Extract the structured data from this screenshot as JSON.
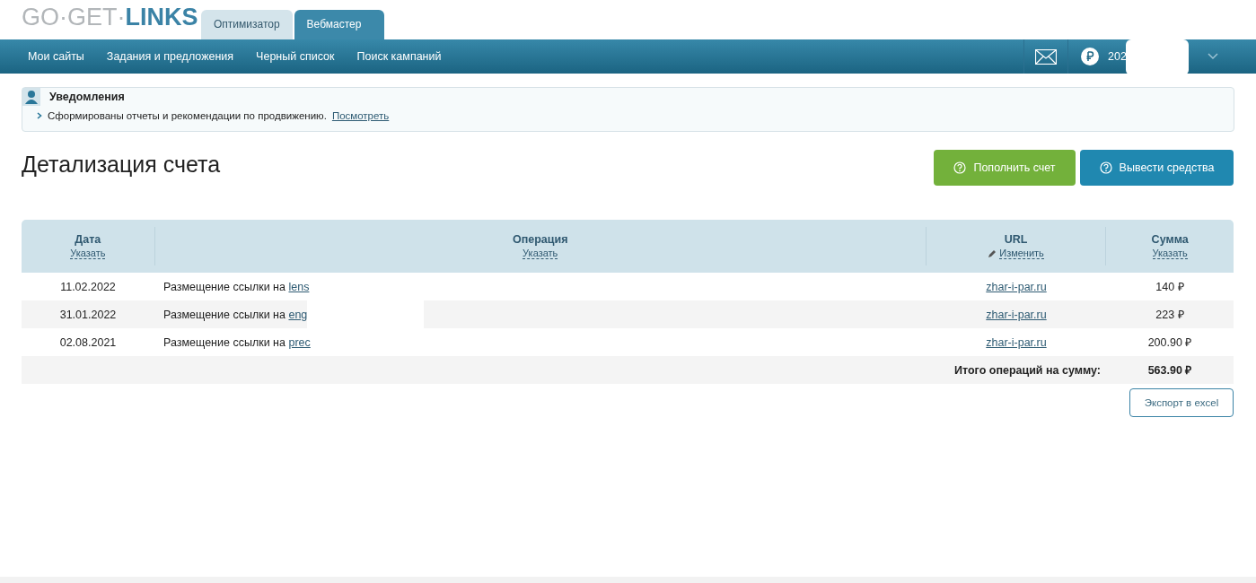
{
  "logo": "GO·GET·**LINKS**",
  "top_tabs": [
    {
      "label": "Оптимизатор",
      "selected": false
    },
    {
      "label": "Вебмастер",
      "selected": true
    }
  ],
  "nav": {
    "items": [
      "Мои сайты",
      "Задания и предложения",
      "Черный список",
      "Поиск кампаний"
    ],
    "balance": "202"
  },
  "notifications": {
    "title": "Уведомления",
    "message": "Сформированы отчеты и рекомендации по продвижению.",
    "link": "Посмотреть"
  },
  "page_title": "Детализация счета",
  "actions": [
    {
      "label": "Пополнить счет",
      "kind": "green"
    },
    {
      "label": "Вывести средства",
      "kind": "blue"
    }
  ],
  "table": {
    "columns": [
      {
        "title": "Дата",
        "action": "Указать",
        "kind": "sort"
      },
      {
        "title": "Операция",
        "action": "Указать",
        "kind": "sort"
      },
      {
        "title": "URL",
        "action": "Изменить",
        "kind": "edit"
      },
      {
        "title": "Сумма",
        "action": "Указать",
        "kind": "sort"
      }
    ],
    "rows": [
      {
        "date": "11.02.2022",
        "operation": "Размещение ссылки на",
        "target": "lens",
        "url": "zhar-i-par.ru",
        "sum": "140 ₽"
      },
      {
        "date": "31.01.2022",
        "operation": "Размещение ссылки на",
        "target": "eng",
        "url": "zhar-i-par.ru",
        "sum": "223 ₽"
      },
      {
        "date": "02.08.2021",
        "operation": "Размещение ссылки на",
        "target": "prec",
        "url": "zhar-i-par.ru",
        "sum": "200.90 ₽"
      }
    ],
    "total_label": "Итого операций на сумму:",
    "total": "563.90 ₽"
  },
  "export_button": "Экспорт в excel"
}
